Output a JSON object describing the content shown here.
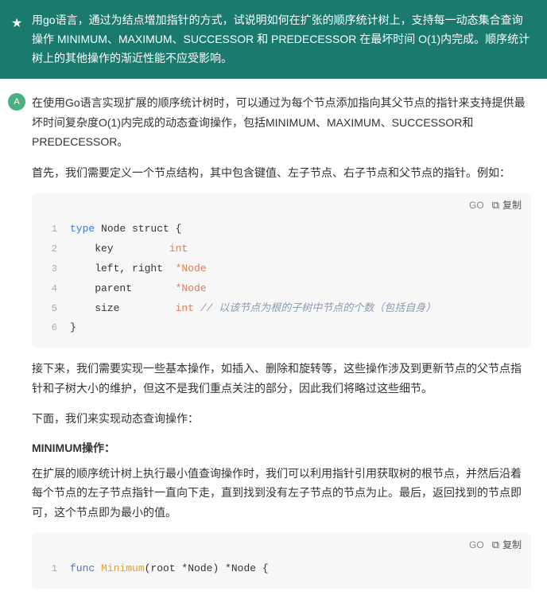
{
  "banner": {
    "icon": "★",
    "text": "用go语言，通过为结点增加指针的方式，试说明如何在扩张的顺序统计树上，支持每一动态集合查询操作 MINIMUM、MAXIMUM、SUCCESSOR 和 PREDECESSOR 在最坏时间 O(1)内完成。顺序统计树上的其他操作的渐近性能不应受影响。"
  },
  "response": {
    "avatar": "A",
    "intro": "在使用Go语言实现扩展的顺序统计树时，可以通过为每个节点添加指向其父节点的指针来支持提供最坏时间复杂度O(1)内完成的动态查询操作，包括MINIMUM、MAXIMUM、SUCCESSOR和PREDECESSOR。",
    "step1": "首先，我们需要定义一个节点结构，其中包含键值、左子节点、右子节点和父节点的指针。例如：",
    "code1": {
      "lang": "GO",
      "copy_label": "复制",
      "lines": [
        {
          "num": "1",
          "tokens": [
            {
              "t": "type ",
              "c": "kw"
            },
            {
              "t": "Node struct {",
              "c": "punc"
            }
          ]
        },
        {
          "num": "2",
          "tokens": [
            {
              "t": "    key         ",
              "c": "field"
            },
            {
              "t": "int",
              "c": "type"
            }
          ]
        },
        {
          "num": "3",
          "tokens": [
            {
              "t": "    left, right  ",
              "c": "field"
            },
            {
              "t": "*Node",
              "c": "type"
            }
          ]
        },
        {
          "num": "4",
          "tokens": [
            {
              "t": "    parent       ",
              "c": "field"
            },
            {
              "t": "*Node",
              "c": "type"
            }
          ]
        },
        {
          "num": "5",
          "tokens": [
            {
              "t": "    size         ",
              "c": "field"
            },
            {
              "t": "int ",
              "c": "type"
            },
            {
              "t": "// 以该节点为根的子树中节点的个数（包括自身）",
              "c": "comment"
            }
          ]
        },
        {
          "num": "6",
          "tokens": [
            {
              "t": "}",
              "c": "punc"
            }
          ]
        }
      ]
    },
    "step2": "接下来，我们需要实现一些基本操作，如插入、删除和旋转等，这些操作涉及到更新节点的父节点指针和子树大小的维护，但这不是我们重点关注的部分，因此我们将略过这些细节。",
    "step3": "下面，我们来实现动态查询操作：",
    "section_minimum": "MINIMUM操作：",
    "text_minimum": "在扩展的顺序统计树上执行最小值查询操作时，我们可以利用指针引用获取树的根节点，并然后沿着每个节点的左子节点指针一直向下走，直到找到没有左子节点的节点为止。最后，返回找到的节点即可，这个节点即为最小的值。",
    "code2": {
      "lang": "GO",
      "copy_label": "复制",
      "lines": [
        {
          "num": "1",
          "tokens": [
            {
              "t": "func ",
              "c": "kw"
            },
            {
              "t": "Minimum",
              "c": "fn-name"
            },
            {
              "t": "(root *Node) *Node {",
              "c": "punc"
            }
          ]
        }
      ]
    }
  }
}
